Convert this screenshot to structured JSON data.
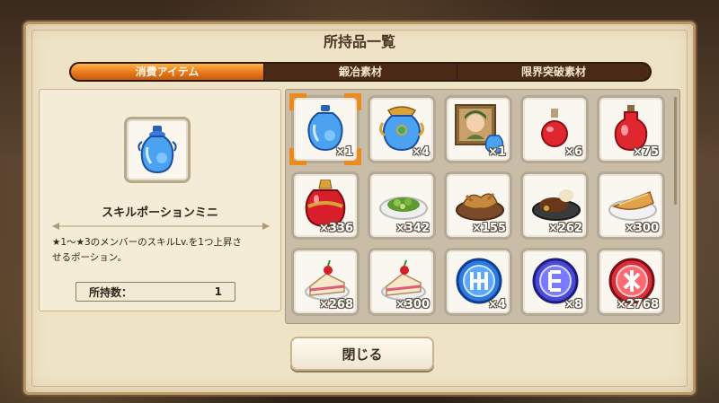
{
  "title": "所持品一覧",
  "tabs": [
    {
      "label": "消費アイテム",
      "active": true
    },
    {
      "label": "鍛冶素材",
      "active": false
    },
    {
      "label": "限界突破素材",
      "active": false
    }
  ],
  "detail": {
    "icon": "skill-potion-mini-icon",
    "name": "スキルポーションミニ",
    "description_line1": "★1～★3のメンバーのスキルLv.を1つ上昇さ",
    "description_line2": "せるポーション。",
    "count_label": "所持数：",
    "count_value": "1"
  },
  "items": [
    {
      "icon": "skill-potion-mini-icon",
      "qty": "×1"
    },
    {
      "icon": "skill-potion-icon",
      "qty": "×4"
    },
    {
      "icon": "character-portrait-potion-icon",
      "qty": "×1"
    },
    {
      "icon": "red-potion-small-icon",
      "qty": "×6"
    },
    {
      "icon": "red-potion-icon",
      "qty": "×75"
    },
    {
      "icon": "red-potion-large-icon",
      "qty": "×336"
    },
    {
      "icon": "salad-dish-icon",
      "qty": "×342"
    },
    {
      "icon": "fried-dish-icon",
      "qty": "×155"
    },
    {
      "icon": "steak-dish-icon",
      "qty": "×262"
    },
    {
      "icon": "pie-dish-icon",
      "qty": "×300"
    },
    {
      "icon": "cake-slice-icon",
      "qty": "×268"
    },
    {
      "icon": "cake-slice-icon",
      "qty": "×300"
    },
    {
      "icon": "blue-medal-icon",
      "qty": "×4"
    },
    {
      "icon": "purple-medal-icon",
      "qty": "×8"
    },
    {
      "icon": "red-medal-icon",
      "qty": "×2768"
    }
  ],
  "close_label": "閉じる",
  "colors": {
    "accent": "#e8781c",
    "panel": "#efe3c6",
    "tab_bg": "#4a2a16"
  }
}
